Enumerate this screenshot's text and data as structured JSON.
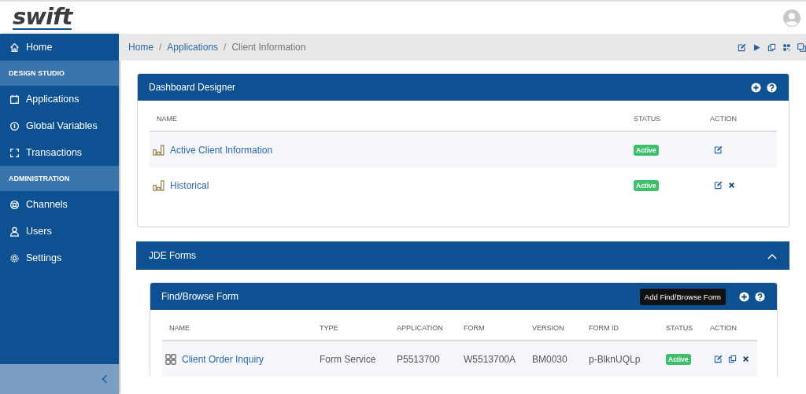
{
  "header": {
    "logo": "swift"
  },
  "sidebar": {
    "items": [
      {
        "kind": "link",
        "label": "Home"
      },
      {
        "kind": "section",
        "label": "DESIGN STUDIO"
      },
      {
        "kind": "link",
        "label": "Applications"
      },
      {
        "kind": "link",
        "label": "Global Variables"
      },
      {
        "kind": "link",
        "label": "Transactions"
      },
      {
        "kind": "section",
        "label": "ADMINISTRATION"
      },
      {
        "kind": "link",
        "label": "Channels"
      },
      {
        "kind": "link",
        "label": "Users"
      },
      {
        "kind": "link",
        "label": "Settings"
      }
    ]
  },
  "breadcrumb": {
    "items": [
      "Home",
      "Applications",
      "Client Information"
    ],
    "separators": [
      "/",
      "/"
    ]
  },
  "dashboard": {
    "title": "Dashboard Designer",
    "columns": [
      "NAME",
      "STATUS",
      "ACTION"
    ],
    "rows": [
      {
        "name": "Active Client Information",
        "status": "Active",
        "deletable": false
      },
      {
        "name": "Historical",
        "status": "Active",
        "deletable": true
      }
    ]
  },
  "jde_forms": {
    "title": "JDE Forms",
    "expanded": true,
    "find_browse": {
      "title": "Find/Browse Form",
      "tooltip": "Add Find/Browse Form",
      "columns": [
        "NAME",
        "TYPE",
        "APPLICATION",
        "FORM",
        "VERSION",
        "FORM ID",
        "STATUS",
        "ACTION"
      ],
      "rows": [
        {
          "cells": [
            "Client Order Inquiry",
            "Form Service",
            "P5513700",
            "W5513700A",
            "BM0030",
            "p-BlknUQLp"
          ],
          "status": "Active",
          "deletable": true
        }
      ]
    }
  }
}
